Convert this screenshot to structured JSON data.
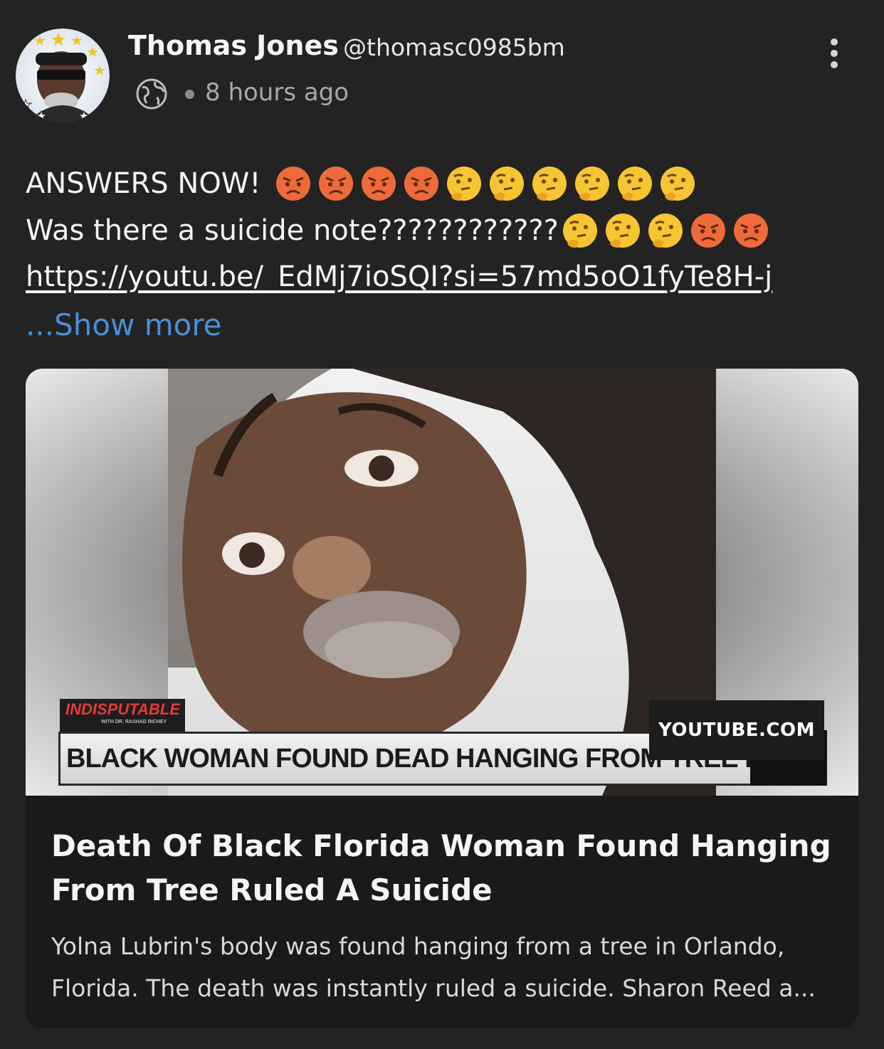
{
  "post": {
    "author_name": "Thomas Jones",
    "author_handle": "@thomasc0985bm",
    "visibility_icon": "globe-icon",
    "timestamp": "8 hours ago",
    "menu_icon": "more-vertical-icon",
    "text_line1": "ANSWERS NOW!",
    "text_line1_emojis": [
      "angry",
      "angry",
      "angry",
      "angry",
      "thinking",
      "thinking",
      "thinking",
      "thinking",
      "thinking",
      "thinking"
    ],
    "text_line2": "Was there a suicide note????????????",
    "text_line2_emojis": [
      "thinking",
      "thinking",
      "thinking",
      "angry",
      "angry"
    ],
    "link": "https://youtu.be/_EdMj7ioSQI?si=57md5oO1fyTe8H-j",
    "show_more": "...Show more"
  },
  "preview": {
    "banner_brand": "INDISPUTABLE",
    "banner_brand_sub": "WITH DR. RASHAD RICHEY",
    "banner_headline": "BLACK WOMAN FOUND DEAD HANGING FROM TREE IN FLORIDA",
    "source": "YOUTUBE.COM",
    "title": "Death Of Black Florida Woman Found Hanging From Tree Ruled A Suicide",
    "description": "Yolna Lubrin's body was found hanging from a tree in Orlando, Florida. The death was instantly ruled a suicide. Sharon Reed a..."
  },
  "colors": {
    "background": "#232323",
    "card": "#1a1a1a",
    "link_blue": "#4a8fd8",
    "muted_text": "#a8a8a8"
  }
}
